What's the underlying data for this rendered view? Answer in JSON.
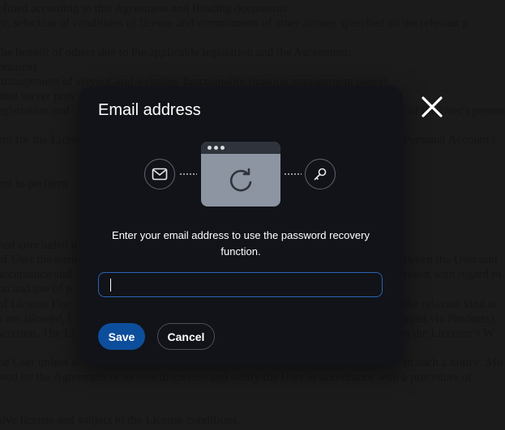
{
  "background_document": {
    "lines": [
      "efined according to this Agreement and Binding documents.",
      "or, selection of conditions of license and commitment of other actions specified on the relevant p",
      "",
      " the benefit of others due to the applicable legislation and the Agreement.",
      "omains)",
      " management of servers' and websites' functionality (hosting management panel).",
      "ated server prov",
      "egistration and",
      "",
      "ent for the Licen",
      "",
      "",
      "ent to perform",
      "",
      "",
      "",
      "ned concluded u",
      "of User the term",
      "acceptance and",
      "on and use of p",
      "of License Fee",
      "s are allowed, l",
      "scretion. The Li",
      "",
      "he User unless o",
      "ated by the Agreement at its sole discretion and notify the User in accordance with a procedure of",
      "",
      "",
      "sive license and subject to the License conditions."
    ],
    "right_fragments": [
      "of the User's person",
      "Personal Account t",
      "tween the User and",
      "taken with regard to",
      "the relevant kind ar",
      "aged via Products),",
      "n the Licensor's W",
      "in such a notice. Mo"
    ]
  },
  "modal": {
    "title": "Email address",
    "description": "Enter your email address to use the password recovery function.",
    "email_input": {
      "value": "",
      "placeholder": ""
    },
    "save_label": "Save",
    "cancel_label": "Cancel"
  },
  "icons": {
    "close": "close-icon",
    "mail": "mail-icon",
    "refresh": "refresh-icon",
    "key": "key-icon"
  },
  "colors": {
    "modal_bg": "#111318",
    "accent": "#0d4e9c",
    "input_border": "#2a63b5"
  }
}
